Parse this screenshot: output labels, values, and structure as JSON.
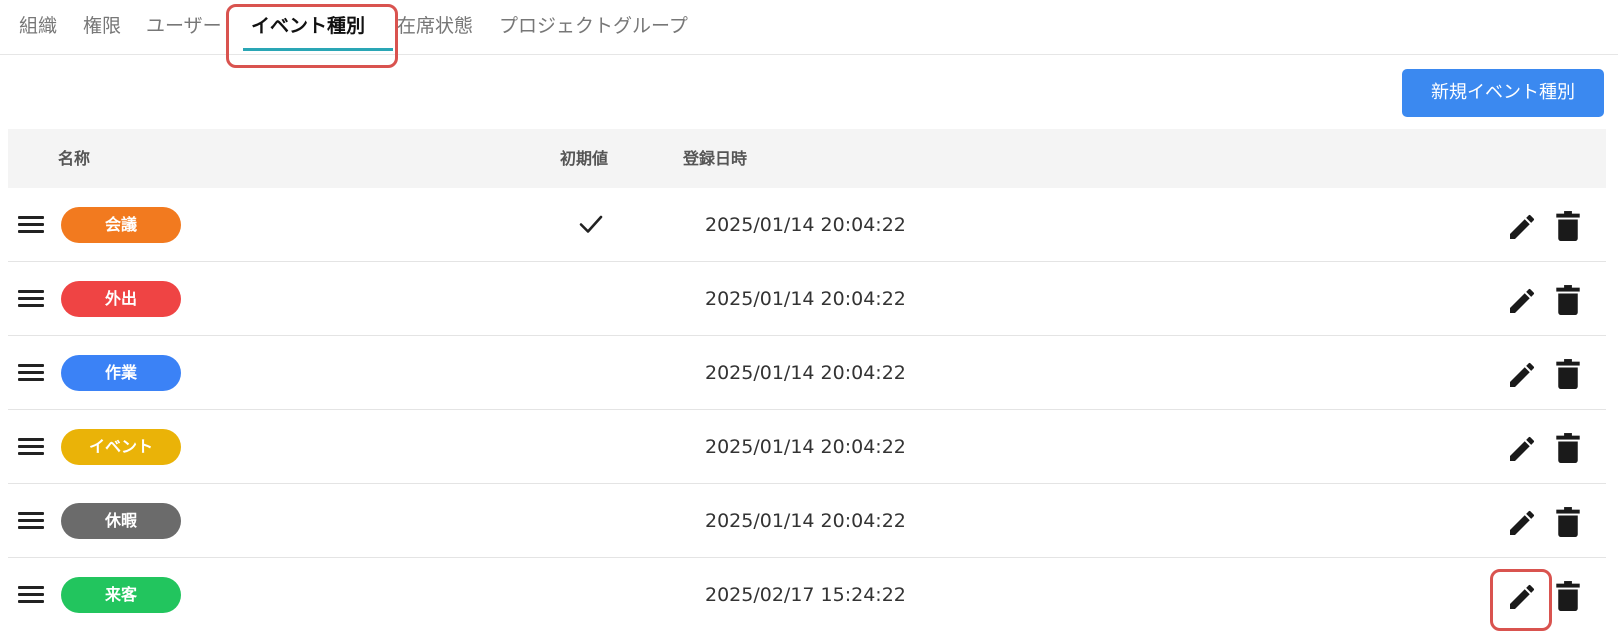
{
  "tabs": [
    {
      "label": "組織",
      "active": false
    },
    {
      "label": "権限",
      "active": false
    },
    {
      "label": "ユーザー",
      "active": false
    },
    {
      "label": "イベント種別",
      "active": true
    },
    {
      "label": "在席状態",
      "active": false
    },
    {
      "label": "プロジェクトグループ",
      "active": false
    }
  ],
  "toolbar": {
    "new_button_label": "新規イベント種別"
  },
  "table": {
    "headers": {
      "name": "名称",
      "default": "初期値",
      "registered": "登録日時"
    },
    "rows": [
      {
        "name": "会議",
        "color": "#f27a1f",
        "is_default": true,
        "registered_at": "2025/01/14 20:04:22"
      },
      {
        "name": "外出",
        "color": "#ef4444",
        "is_default": false,
        "registered_at": "2025/01/14 20:04:22"
      },
      {
        "name": "作業",
        "color": "#3b82f6",
        "is_default": false,
        "registered_at": "2025/01/14 20:04:22"
      },
      {
        "name": "イベント",
        "color": "#eab308",
        "is_default": false,
        "registered_at": "2025/01/14 20:04:22"
      },
      {
        "name": "休暇",
        "color": "#6b6b6b",
        "is_default": false,
        "registered_at": "2025/01/14 20:04:22"
      },
      {
        "name": "来客",
        "color": "#22c55e",
        "is_default": false,
        "registered_at": "2025/02/17 15:24:22"
      }
    ]
  },
  "icons": {
    "drag": "drag-handle-icon",
    "check": "check-icon",
    "edit": "pencil-icon",
    "delete": "trash-icon"
  },
  "colors": {
    "primary_button": "#3b89f0",
    "tab_underline": "#2aa6b5",
    "highlight": "#d9534f"
  }
}
